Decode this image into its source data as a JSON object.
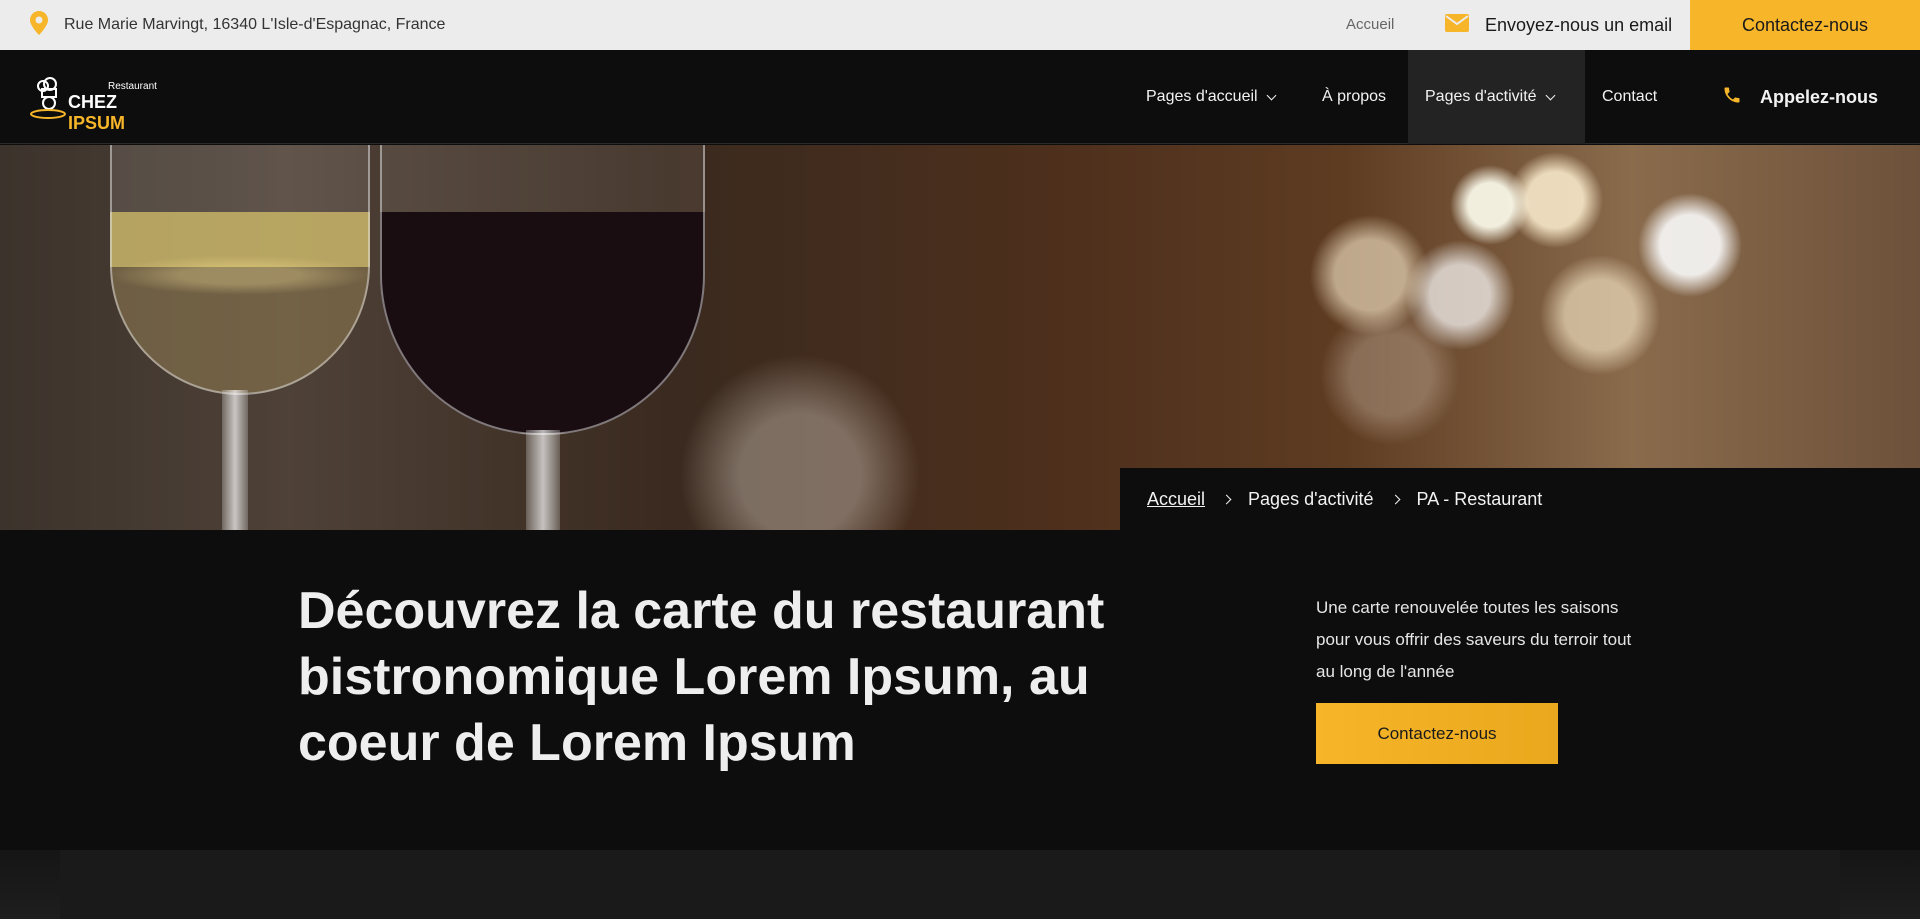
{
  "topbar": {
    "address": "Rue Marie Marvingt, 16340 L'Isle-d'Espagnac, France",
    "home_link": "Accueil",
    "email_label": "Envoyez-nous un email",
    "contact_button": "Contactez-nous"
  },
  "logo": {
    "small": "Restaurant",
    "brand_white": "CHEZ ",
    "brand_accent": "IPSUM"
  },
  "nav": {
    "items": [
      {
        "label": "Pages d'accueil",
        "dropdown": true
      },
      {
        "label": "À propos",
        "dropdown": false
      },
      {
        "label": "Pages d'activité",
        "dropdown": true,
        "active": true
      },
      {
        "label": "Contact",
        "dropdown": false
      }
    ],
    "call_label": "Appelez-nous"
  },
  "breadcrumb": {
    "items": [
      "Accueil",
      "Pages d'activité",
      "PA - Restaurant"
    ]
  },
  "intro": {
    "title": "Découvrez la carte du restaurant bistronomique Lorem Ipsum, au coeur de Lorem Ipsum",
    "text": "Une carte renouvelée toutes les saisons pour vous offrir des saveurs du terroir tout au long de l'année",
    "button": "Contactez-nous"
  },
  "colors": {
    "accent": "#f7b529",
    "background": "#0d0d0d",
    "topbar": "#ececec"
  },
  "icons": [
    "map-pin-icon",
    "envelope-icon",
    "phone-icon",
    "chef-logo-icon",
    "chevron-down-icon",
    "chevron-right-icon"
  ]
}
